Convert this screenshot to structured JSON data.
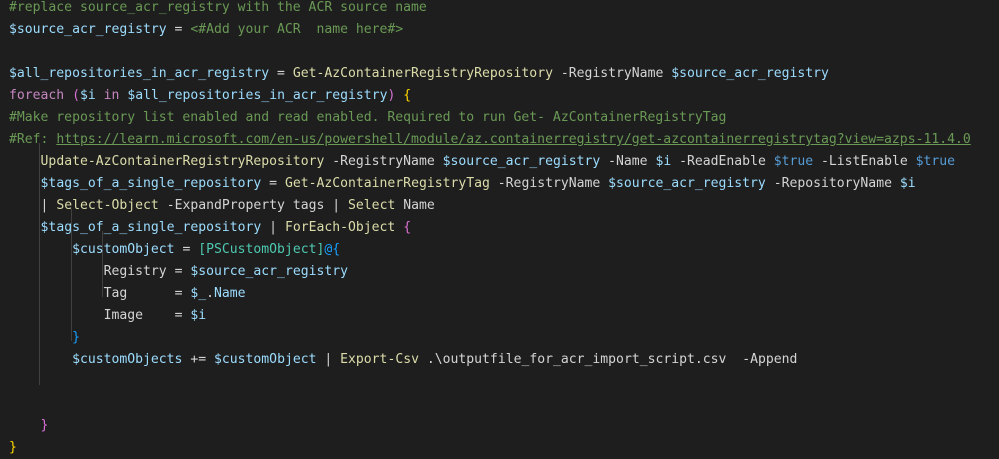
{
  "colors": {
    "background": "#1e1e1e",
    "comment": "#6a9955",
    "variable": "#9cdcfe",
    "function": "#dcdcaa",
    "keyword": "#c586c0",
    "default": "#d4d4d4",
    "boolean": "#569cd6",
    "type": "#4ec9b0",
    "brace_level1": "#ffd700",
    "brace_level2": "#da70d6",
    "brace_level3": "#179fff"
  },
  "lines": [
    [
      {
        "t": "comment",
        "v": "#replace source_acr_registry with the ACR source name"
      }
    ],
    [
      {
        "t": "variable",
        "v": "$source_acr_registry"
      },
      {
        "t": "operator",
        "v": " = "
      },
      {
        "t": "comment",
        "v": "<#Add your ACR  name here#>"
      }
    ],
    [],
    [
      {
        "t": "variable",
        "v": "$all_repositories_in_acr_registry"
      },
      {
        "t": "operator",
        "v": " = "
      },
      {
        "t": "function",
        "v": "Get-AzContainerRegistryRepository"
      },
      {
        "t": "param",
        "v": " -RegistryName "
      },
      {
        "t": "variable",
        "v": "$source_acr_registry"
      }
    ],
    [
      {
        "t": "keyword",
        "v": "foreach"
      },
      {
        "t": "text",
        "v": " "
      },
      {
        "t": "brace-p",
        "v": "("
      },
      {
        "t": "variable",
        "v": "$i"
      },
      {
        "t": "text",
        "v": " "
      },
      {
        "t": "keyword",
        "v": "in"
      },
      {
        "t": "text",
        "v": " "
      },
      {
        "t": "variable",
        "v": "$all_repositories_in_acr_registry"
      },
      {
        "t": "brace-p",
        "v": ")"
      },
      {
        "t": "text",
        "v": " "
      },
      {
        "t": "brace-y",
        "v": "{"
      }
    ],
    [
      {
        "t": "comment",
        "v": "#Make repository list enabled and read enabled. Required to run Get- AzContainerRegistryTag"
      }
    ],
    [
      {
        "t": "comment",
        "v": "#Ref: "
      },
      {
        "t": "link",
        "v": "https://learn.microsoft.com/en-us/powershell/module/az.containerregistry/get-azcontainerregistrytag?view=azps-11.4.0"
      }
    ],
    [
      {
        "t": "text",
        "v": "    "
      },
      {
        "t": "function",
        "v": "Update-AzContainerRegistryRepository"
      },
      {
        "t": "param",
        "v": " -RegistryName "
      },
      {
        "t": "variable",
        "v": "$source_acr_registry"
      },
      {
        "t": "param",
        "v": " -Name "
      },
      {
        "t": "variable",
        "v": "$i"
      },
      {
        "t": "param",
        "v": " -ReadEnable "
      },
      {
        "t": "bool",
        "v": "$true"
      },
      {
        "t": "param",
        "v": " -ListEnable "
      },
      {
        "t": "bool",
        "v": "$true"
      }
    ],
    [
      {
        "t": "text",
        "v": "    "
      },
      {
        "t": "variable",
        "v": "$tags_of_a_single_repository"
      },
      {
        "t": "operator",
        "v": " = "
      },
      {
        "t": "function",
        "v": "Get-AzContainerRegistryTag"
      },
      {
        "t": "param",
        "v": " -RegistryName "
      },
      {
        "t": "variable",
        "v": "$source_acr_registry"
      },
      {
        "t": "param",
        "v": " -RepositoryName "
      },
      {
        "t": "variable",
        "v": "$i"
      }
    ],
    [
      {
        "t": "text",
        "v": "    "
      },
      {
        "t": "operator",
        "v": "| "
      },
      {
        "t": "function",
        "v": "Select-Object"
      },
      {
        "t": "param",
        "v": " -ExpandProperty tags "
      },
      {
        "t": "operator",
        "v": "| "
      },
      {
        "t": "function",
        "v": "Select"
      },
      {
        "t": "param",
        "v": " Name"
      }
    ],
    [
      {
        "t": "text",
        "v": "    "
      },
      {
        "t": "variable",
        "v": "$tags_of_a_single_repository"
      },
      {
        "t": "operator",
        "v": " | "
      },
      {
        "t": "function",
        "v": "ForEach-Object"
      },
      {
        "t": "text",
        "v": " "
      },
      {
        "t": "brace-p",
        "v": "{"
      }
    ],
    [
      {
        "t": "text",
        "v": "        "
      },
      {
        "t": "variable",
        "v": "$customObject"
      },
      {
        "t": "operator",
        "v": " = "
      },
      {
        "t": "type",
        "v": "[PSCustomObject]"
      },
      {
        "t": "brace-b",
        "v": "@{"
      }
    ],
    [
      {
        "t": "text",
        "v": "            "
      },
      {
        "t": "text",
        "v": "Registry"
      },
      {
        "t": "operator",
        "v": " = "
      },
      {
        "t": "variable",
        "v": "$source_acr_registry"
      }
    ],
    [
      {
        "t": "text",
        "v": "            "
      },
      {
        "t": "text",
        "v": "Tag"
      },
      {
        "t": "operator",
        "v": "      = "
      },
      {
        "t": "variable",
        "v": "$_"
      },
      {
        "t": "text",
        "v": "."
      },
      {
        "t": "variable",
        "v": "Name"
      }
    ],
    [
      {
        "t": "text",
        "v": "            "
      },
      {
        "t": "text",
        "v": "Image"
      },
      {
        "t": "operator",
        "v": "    = "
      },
      {
        "t": "variable",
        "v": "$i"
      }
    ],
    [
      {
        "t": "text",
        "v": "        "
      },
      {
        "t": "brace-b",
        "v": "}"
      }
    ],
    [
      {
        "t": "text",
        "v": "        "
      },
      {
        "t": "variable",
        "v": "$customObjects"
      },
      {
        "t": "operator",
        "v": " += "
      },
      {
        "t": "variable",
        "v": "$customObject"
      },
      {
        "t": "operator",
        "v": " | "
      },
      {
        "t": "function",
        "v": "Export-Csv"
      },
      {
        "t": "param",
        "v": " .\\outputfile_for_acr_import_script.csv  -Append"
      }
    ],
    [],
    [],
    [
      {
        "t": "text",
        "v": "    "
      },
      {
        "t": "brace-p",
        "v": "}"
      }
    ],
    [
      {
        "t": "brace-y",
        "v": "}"
      }
    ]
  ]
}
